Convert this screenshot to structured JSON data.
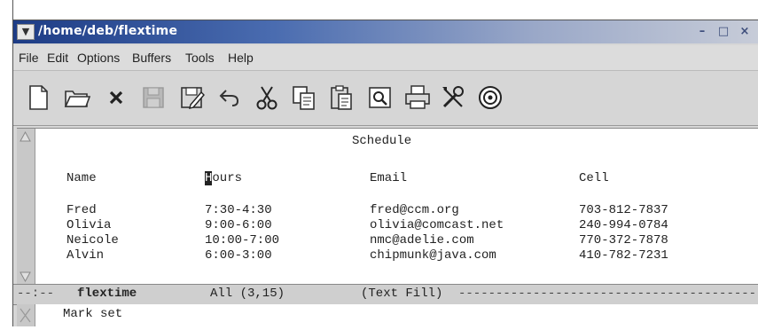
{
  "window": {
    "title": "/home/deb/flextime"
  },
  "menu": [
    "File",
    "Edit",
    "Options",
    "Buffers",
    "Tools",
    "Help"
  ],
  "toolbar": [
    "new-file-icon",
    "open-folder-icon",
    "close-icon",
    "save-icon",
    "save-as-icon",
    "undo-icon",
    "cut-icon",
    "copy-icon",
    "paste-icon",
    "search-icon",
    "print-icon",
    "tools-icon",
    "info-icon"
  ],
  "buffer": {
    "heading": "Schedule",
    "columns": [
      "Name",
      "Hours",
      "Email",
      "Cell"
    ],
    "rows": [
      [
        "Fred",
        "7:30-4:30",
        "fred@ccm.org",
        "703-812-7837"
      ],
      [
        "Olivia",
        "9:00-6:00",
        "olivia@comcast.net",
        "240-994-0784"
      ],
      [
        "Neicole",
        "10:00-7:00",
        "nmc@adelie.com",
        "770-372-7878"
      ],
      [
        "Alvin",
        "6:00-3:00",
        "chipmunk@java.com",
        "410-782-7231"
      ]
    ]
  },
  "modeline": {
    "prefix": "--:--",
    "buffer_name": "flextime",
    "position": "All (3,15)",
    "mode": "(Text Fill)"
  },
  "minibuffer": {
    "message": "Mark set"
  }
}
